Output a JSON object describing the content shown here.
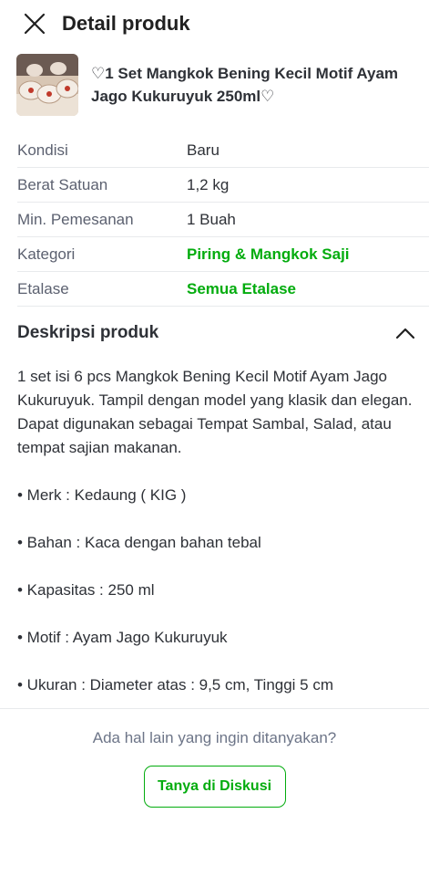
{
  "header": {
    "title": "Detail produk"
  },
  "product": {
    "name": "♡1 Set Mangkok Bening Kecil Motif Ayam Jago Kukuruyuk 250ml♡"
  },
  "specs": [
    {
      "label": "Kondisi",
      "value": "Baru"
    },
    {
      "label": "Berat Satuan",
      "value": "1,2 kg"
    },
    {
      "label": "Min. Pemesanan",
      "value": "1 Buah"
    },
    {
      "label": "Kategori",
      "value": "Piring & Mangkok Saji"
    },
    {
      "label": "Etalase",
      "value": "Semua Etalase"
    }
  ],
  "description": {
    "title": "Deskripsi produk",
    "paragraph": "1 set isi 6 pcs Mangkok Bening Kecil Motif Ayam Jago Kukuruyuk. Tampil dengan model yang klasik dan elegan. Dapat digunakan sebagai Tempat Sambal, Salad, atau tempat sajian makanan.",
    "bullets": [
      "• Merk : Kedaung ( KIG )",
      "• Bahan : Kaca dengan bahan tebal",
      "• Kapasitas : 250 ml",
      "• Motif : Ayam Jago Kukuruyuk",
      "• Ukuran : Diameter atas : 9,5 cm, Tinggi 5 cm"
    ]
  },
  "ask": {
    "prompt": "Ada hal lain yang ingin ditanyakan?",
    "button_label": "Tanya di Diskusi"
  },
  "colors": {
    "accent": "#03ac0e",
    "text": "#2e3137",
    "muted": "#6d7588"
  },
  "icons": {
    "close": "close-icon",
    "collapse": "chevron-up-icon"
  }
}
